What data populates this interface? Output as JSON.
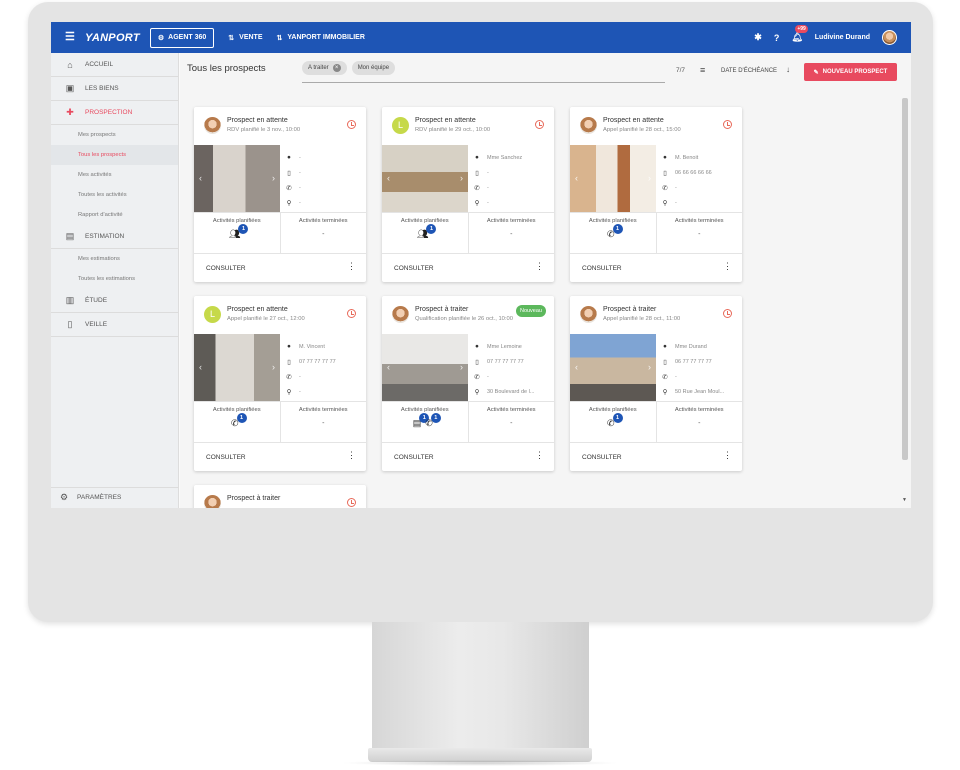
{
  "topbar": {
    "logo": "YANPORT",
    "agent_button": "AGENT 360",
    "nav": [
      "VENTE",
      "YANPORT IMMOBILIER"
    ],
    "notifications_badge": "+99",
    "user_name": "Ludivine Durand"
  },
  "sidebar": {
    "items": [
      {
        "label": "ACCUEIL",
        "icon": "home-icon"
      },
      {
        "label": "LES BIENS",
        "icon": "biens-icon"
      },
      {
        "label": "PROSPECTION",
        "icon": "person-add-icon"
      },
      {
        "label": "ESTIMATION",
        "icon": "estimation-icon"
      },
      {
        "label": "ÉTUDE",
        "icon": "etude-icon"
      },
      {
        "label": "VEILLE",
        "icon": "veille-icon"
      }
    ],
    "prospection_sub": [
      "Mes prospects",
      "Tous les prospects",
      "Mes activités",
      "Toutes les activités",
      "Rapport d'activité"
    ],
    "estimation_sub": [
      "Mes estimations",
      "Toutes les estimations"
    ],
    "settings": "PARAMÈTRES",
    "colors": {
      "active": "#e84a5f",
      "brand": "#1e55b5"
    }
  },
  "header": {
    "title": "Tous les prospects",
    "chips": [
      "A traiter",
      "Mon équipe"
    ],
    "count": "7/7",
    "sort_label": "DATE D'ÉCHÉANCE",
    "new_button": "NOUVEAU PROSPECT"
  },
  "card_labels": {
    "planned": "Activités planifiées",
    "done": "Activités terminées",
    "consult": "CONSULTER",
    "dash": "-"
  },
  "cards": [
    {
      "status": "Prospect en attente",
      "sub": "RDV planifié le 3 nov., 10:00",
      "contact": "-",
      "phone": "-",
      "address": "-",
      "badge": "1"
    },
    {
      "status": "Prospect en attente",
      "sub": "RDV planifié le 29 oct., 10:00",
      "contact": "Mme Sanchez",
      "phone": "-",
      "address": "-",
      "badge": "1",
      "letter": "L"
    },
    {
      "status": "Prospect en attente",
      "sub": "Appel planifié le 28 oct., 15:00",
      "contact": "M. Benoit",
      "phone": "06 66 66 66 66",
      "address": "-",
      "badge": "1"
    },
    {
      "status": "Prospect en attente",
      "sub": "Appel planifié le 27 oct., 12:00",
      "contact": "M. Vincent",
      "phone": "07 77 77 77 77",
      "address": "-",
      "badge": "1",
      "letter": "L"
    },
    {
      "status": "Prospect à traiter",
      "sub": "Qualification planifiée le 26 oct., 10:00",
      "contact": "Mme Lemoine",
      "phone": "07 77 77 77 77",
      "address": "30 Boulevard de l...",
      "badge": "1",
      "badge2": "1",
      "new_badge": "Nouveau"
    },
    {
      "status": "Prospect à traiter",
      "sub": "Appel planifié le 28 oct., 11:00",
      "contact": "Mme Durand",
      "phone": "06 77 77 77 77",
      "address": "50 Rue Jean Moul...",
      "badge": "1"
    },
    {
      "status": "Prospect à traiter"
    }
  ]
}
